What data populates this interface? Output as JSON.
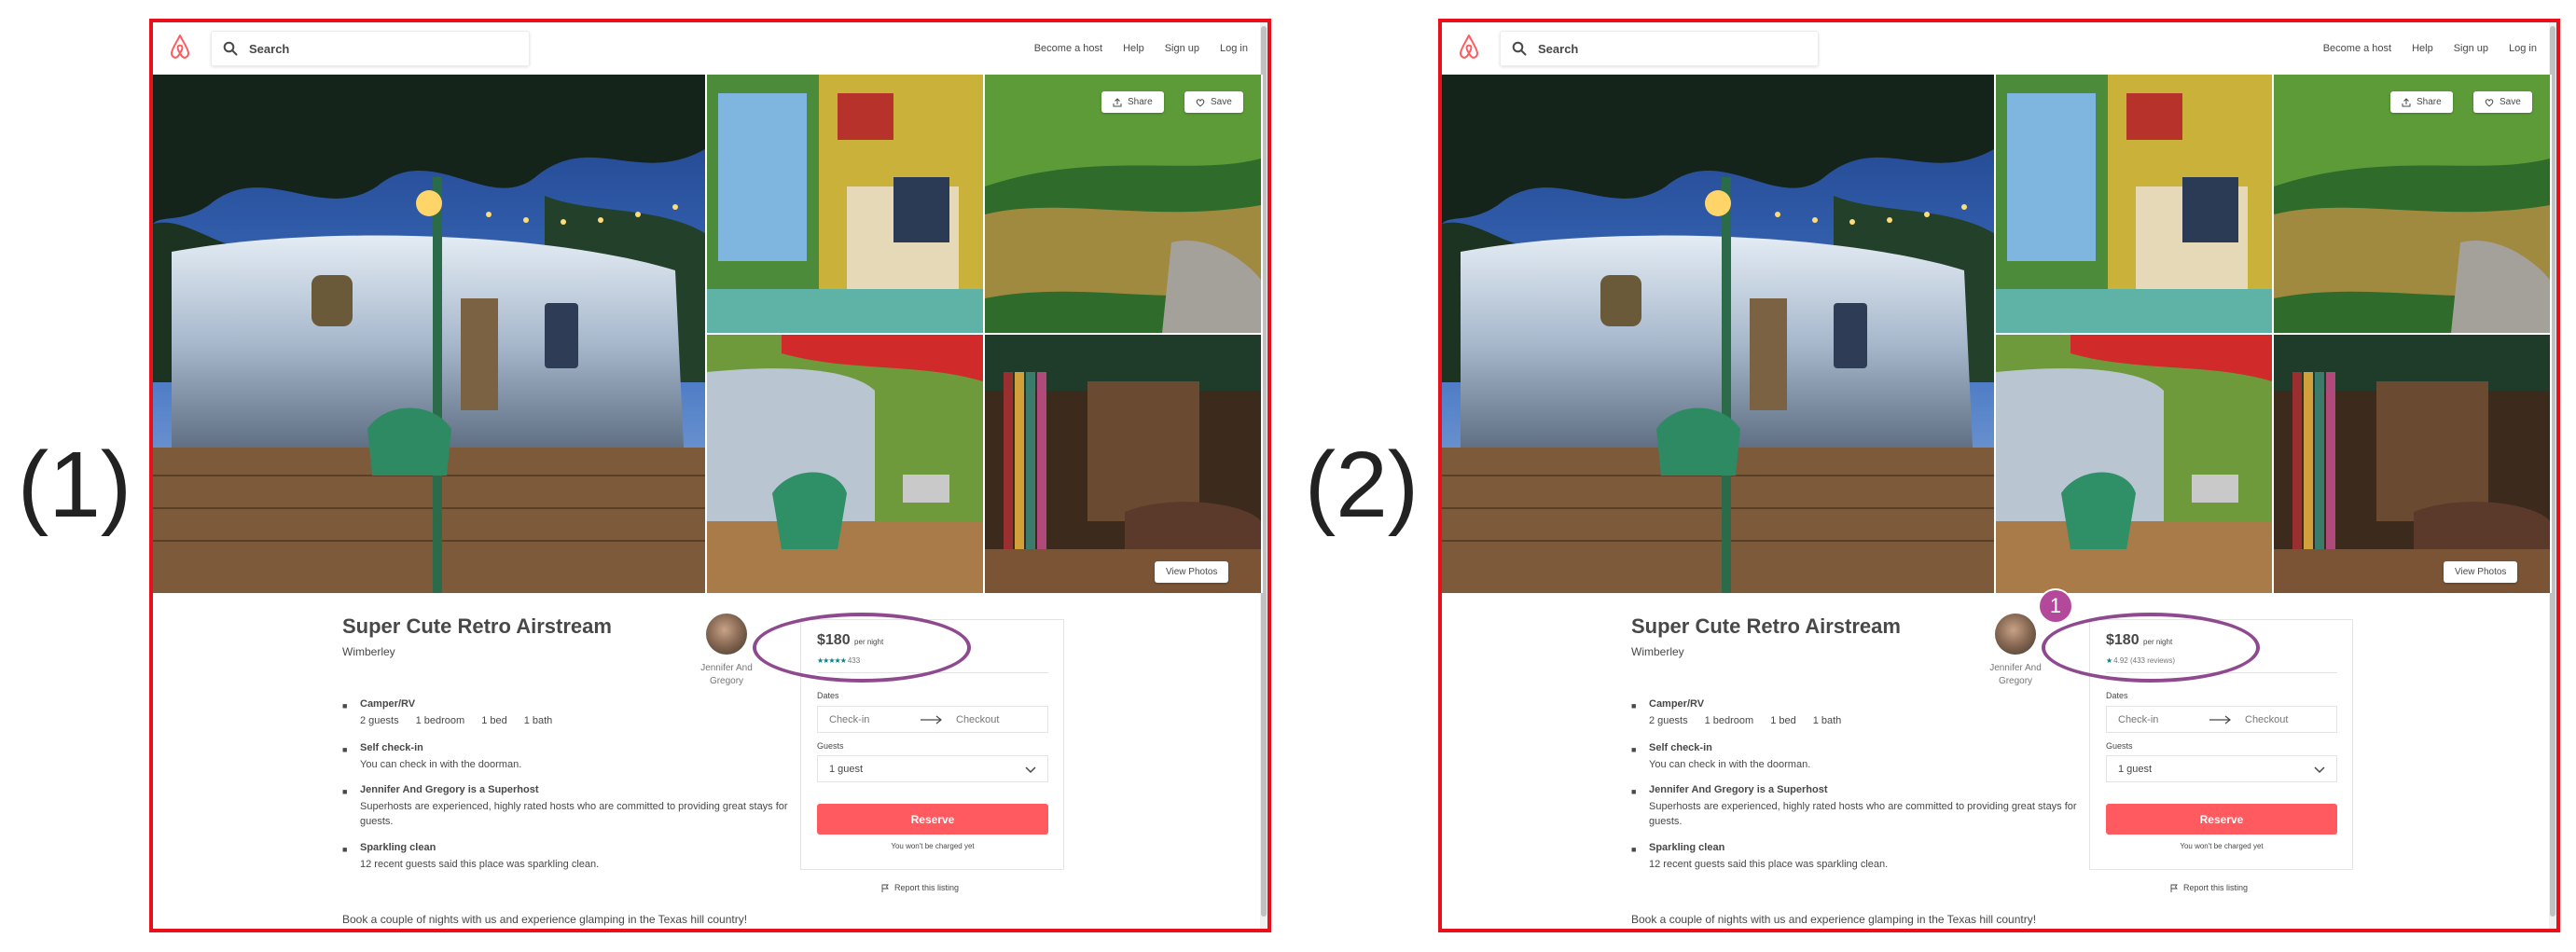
{
  "panels": [
    {
      "label": "(1)",
      "header": {
        "search_placeholder": "Search",
        "nav": [
          "Become a host",
          "Help",
          "Sign up",
          "Log in"
        ]
      },
      "photo_buttons": {
        "share": "Share",
        "save": "Save",
        "view_photos": "View Photos"
      },
      "listing": {
        "title": "Super Cute Retro Airstream",
        "location": "Wimberley",
        "host_name_line1": "Jennifer And",
        "host_name_line2": "Gregory",
        "features": [
          {
            "icon": "home-icon",
            "title": "Camper/RV",
            "specs": [
              "2 guests",
              "1 bedroom",
              "1 bed",
              "1 bath"
            ]
          },
          {
            "icon": "key-icon",
            "title": "Self check-in",
            "description": "You can check in with the doorman."
          },
          {
            "icon": "medal-icon",
            "title": "Jennifer And Gregory is a Superhost",
            "description": "Superhosts are experienced, highly rated hosts who are committed to providing great stays for guests."
          },
          {
            "icon": "sparkle-icon",
            "title": "Sparkling clean",
            "description": "12 recent guests said this place was sparkling clean."
          }
        ],
        "description": "Book a couple of nights with us and experience glamping in the Texas hill country!"
      },
      "booking": {
        "price": "$180",
        "per_night": "per night",
        "stars": "★★★★★",
        "rating_text": "433",
        "dates_label": "Dates",
        "checkin_placeholder": "Check-in",
        "checkout_placeholder": "Checkout",
        "guests_label": "Guests",
        "guests_value": "1 guest",
        "reserve_label": "Reserve",
        "no_charge": "You won't be charged yet"
      },
      "report_link": "Report this listing",
      "annotation_badge": ""
    },
    {
      "label": "(2)",
      "header": {
        "search_placeholder": "Search",
        "nav": [
          "Become a host",
          "Help",
          "Sign up",
          "Log in"
        ]
      },
      "photo_buttons": {
        "share": "Share",
        "save": "Save",
        "view_photos": "View Photos"
      },
      "listing": {
        "title": "Super Cute Retro Airstream",
        "location": "Wimberley",
        "host_name_line1": "Jennifer And",
        "host_name_line2": "Gregory",
        "features": [
          {
            "icon": "home-icon",
            "title": "Camper/RV",
            "specs": [
              "2 guests",
              "1 bedroom",
              "1 bed",
              "1 bath"
            ]
          },
          {
            "icon": "key-icon",
            "title": "Self check-in",
            "description": "You can check in with the doorman."
          },
          {
            "icon": "medal-icon",
            "title": "Jennifer And Gregory is a Superhost",
            "description": "Superhosts are experienced, highly rated hosts who are committed to providing great stays for guests."
          },
          {
            "icon": "sparkle-icon",
            "title": "Sparkling clean",
            "description": "12 recent guests said this place was sparkling clean."
          }
        ],
        "description": "Book a couple of nights with us and experience glamping in the Texas hill country!"
      },
      "booking": {
        "price": "$180",
        "per_night": "per night",
        "stars": "★",
        "rating_text": "4.92 (433 reviews)",
        "dates_label": "Dates",
        "checkin_placeholder": "Check-in",
        "checkout_placeholder": "Checkout",
        "guests_label": "Guests",
        "guests_value": "1 guest",
        "reserve_label": "Reserve",
        "no_charge": "You won't be charged yet"
      },
      "report_link": "Report this listing",
      "annotation_badge": "1"
    }
  ],
  "colors": {
    "frame_border": "#e8101b",
    "brand_red": "#ff5a5f",
    "star_teal": "#008489",
    "annotation_purple": "#8f4a8f",
    "badge_magenta": "#b4489a"
  }
}
